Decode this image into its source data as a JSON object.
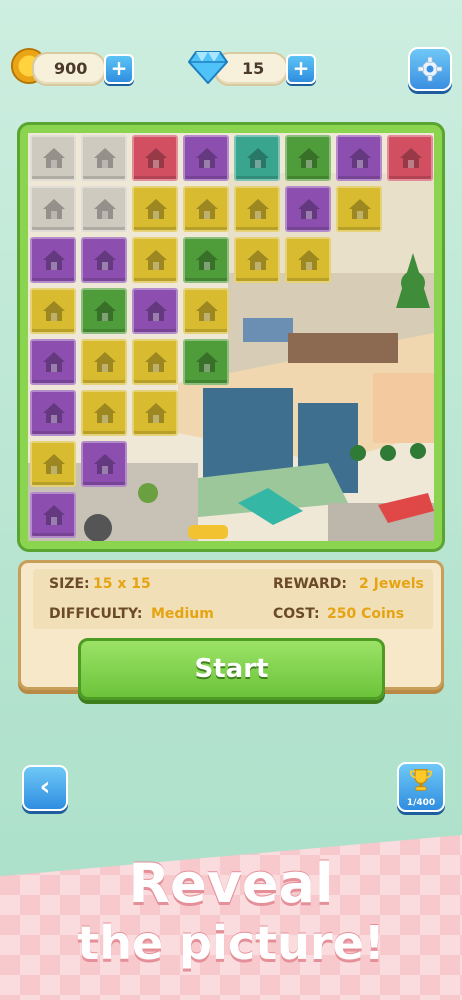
{
  "header": {
    "coins": "900",
    "jewels": "15"
  },
  "level": {
    "size_label": "SIZE:",
    "size_value": "15 x 15",
    "reward_label": "REWARD:",
    "reward_value": "2 Jewels",
    "difficulty_label": "DIFFICULTY:",
    "difficulty_value": "Medium",
    "cost_label": "COST:",
    "cost_value": "250 Coins"
  },
  "actions": {
    "start_label": "Start",
    "progress": "1/400"
  },
  "promo": {
    "line1": "Reveal",
    "line2": "the picture!"
  },
  "colors": {
    "gray": "#cfcac0",
    "red": "#d24f62",
    "purple": "#8c4fb0",
    "teal": "#3aa58f",
    "green": "#4f9c3a",
    "yellow": "#d8bb2f"
  },
  "tiles": [
    [
      "gray",
      "gray",
      "red",
      "purple",
      "teal",
      "green",
      "purple",
      "red"
    ],
    [
      "gray",
      "gray",
      "yellow",
      "yellow",
      "yellow",
      "purple",
      "yellow"
    ],
    [
      "purple",
      "purple",
      "yellow",
      "green",
      "yellow",
      "yellow"
    ],
    [
      "yellow",
      "green",
      "purple",
      "yellow"
    ],
    [
      "purple",
      "yellow",
      "yellow",
      "green"
    ],
    [
      "purple",
      "yellow",
      "yellow"
    ],
    [
      "yellow",
      "purple"
    ],
    [
      "purple"
    ]
  ]
}
